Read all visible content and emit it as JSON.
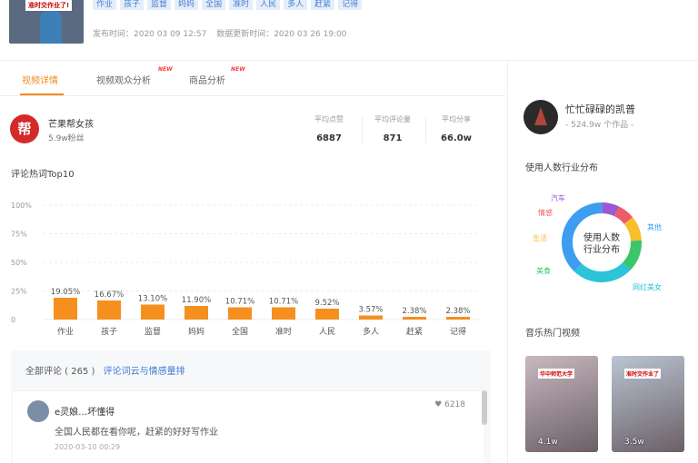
{
  "header": {
    "tags": [
      "作业",
      "孩子",
      "监督",
      "妈妈",
      "全国",
      "准时",
      "人民",
      "多人",
      "赶紧",
      "记得"
    ],
    "thumb_caption": "准时交作业了!",
    "publish_time": "发布时间：2020 03 09 12:57",
    "update_time": "数据更新时间：2020 03 26 19:00"
  },
  "tabs": [
    {
      "label": "视频详情",
      "new": ""
    },
    {
      "label": "视频观众分析",
      "new": "NEW"
    },
    {
      "label": "商品分析",
      "new": "NEW"
    }
  ],
  "account": {
    "avatar_text": "帮",
    "name": "芒果帮女孩",
    "fans": "5.9w粉丝"
  },
  "stats": [
    {
      "label": "平均点赞",
      "value": "6887"
    },
    {
      "label": "平均评论量",
      "value": "871"
    },
    {
      "label": "平均分享",
      "value": "66.0w"
    }
  ],
  "chart_data": {
    "type": "bar",
    "title": "评论热词Top10",
    "categories": [
      "作业",
      "孩子",
      "监督",
      "妈妈",
      "全国",
      "准时",
      "人民",
      "多人",
      "赶紧",
      "记得"
    ],
    "values": [
      19.05,
      16.67,
      13.1,
      11.9,
      10.71,
      10.71,
      9.52,
      3.57,
      2.38,
      2.38
    ],
    "value_labels": [
      "19.05%",
      "16.67%",
      "13.10%",
      "11.90%",
      "10.71%",
      "10.71%",
      "9.52%",
      "3.57%",
      "2.38%",
      "2.38%"
    ],
    "ylim": [
      0,
      100
    ],
    "yticks": [
      "100%",
      "75%",
      "50%",
      "25%",
      "0"
    ],
    "color": "#f5901e",
    "grid": true
  },
  "comments": {
    "header": "全部评论 ( 265 )",
    "link": "评论词云与情感量排",
    "item": {
      "name": "e灵娘…坏懂得",
      "likes": "6218",
      "text": "全国人民都在看你呢，赶紧的好好写作业",
      "time": "2020-03-10 00:29"
    }
  },
  "right": {
    "name": "忙忙碌碌的凯普",
    "sub": "- 524.9w 个作品 -",
    "industry_title": "使用人数行业分布",
    "donut_center": [
      "使用人数",
      "行业分布"
    ],
    "donut_segments": [
      {
        "label": "汽车",
        "color": "#9b59d6"
      },
      {
        "label": "情感",
        "color": "#ee5c6a"
      },
      {
        "label": "生活",
        "color": "#f5c02a"
      },
      {
        "label": "美食",
        "color": "#3cc56a"
      },
      {
        "label": "网红美女",
        "color": "#2bc4d8"
      },
      {
        "label": "其他",
        "color": "#3d9df0"
      }
    ],
    "hot_title": "音乐热门视频",
    "videos": [
      {
        "views": "4.1w",
        "caption": "华中师范大学",
        "bg": "#c9b8c0"
      },
      {
        "views": "3.5w",
        "caption": "准时交作业了",
        "bg": "#b9c5d2"
      }
    ]
  }
}
